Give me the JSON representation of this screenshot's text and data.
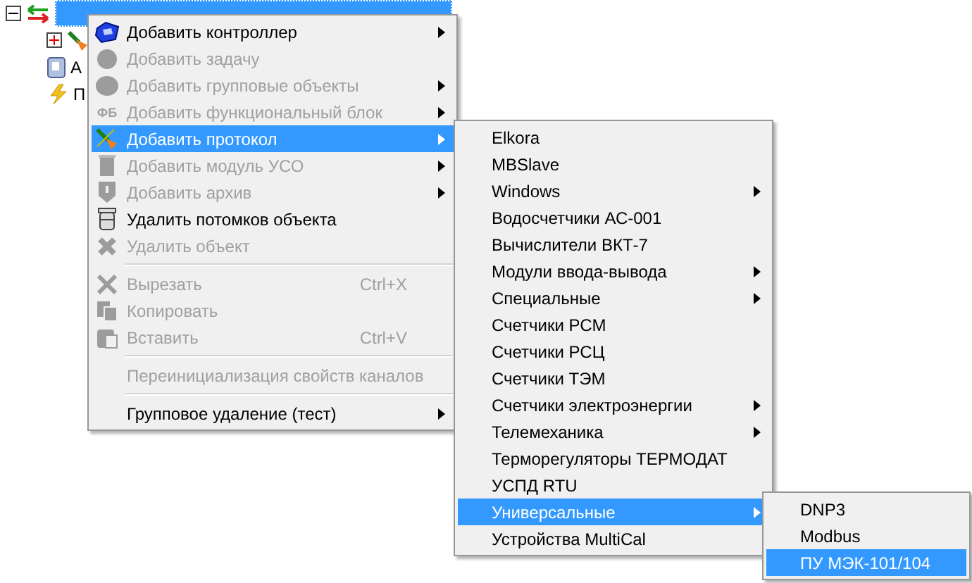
{
  "tree": {
    "items": [
      {
        "expanded": true,
        "selected": true,
        "children": [
          {
            "expanded": false
          },
          {
            "label": "А"
          },
          {
            "label": "П"
          }
        ]
      }
    ]
  },
  "menu": {
    "items": [
      {
        "kind": "item",
        "label": "Добавить контроллер",
        "disabled": false,
        "submenu": true,
        "selected": false
      },
      {
        "kind": "item",
        "label": "Добавить задачу",
        "disabled": true,
        "submenu": false,
        "selected": false
      },
      {
        "kind": "item",
        "label": "Добавить групповые объекты",
        "disabled": true,
        "submenu": true,
        "selected": false
      },
      {
        "kind": "item",
        "label": "Добавить функциональный блок",
        "disabled": true,
        "submenu": true,
        "selected": false,
        "icon_text": "ФБ"
      },
      {
        "kind": "item",
        "label": "Добавить протокол",
        "disabled": false,
        "submenu": true,
        "selected": true
      },
      {
        "kind": "item",
        "label": "Добавить модуль УСО",
        "disabled": true,
        "submenu": true,
        "selected": false
      },
      {
        "kind": "item",
        "label": "Добавить архив",
        "disabled": true,
        "submenu": true,
        "selected": false
      },
      {
        "kind": "item",
        "label": "Удалить потомков объекта",
        "disabled": false,
        "submenu": false,
        "selected": false
      },
      {
        "kind": "item",
        "label": "Удалить объект",
        "disabled": true,
        "submenu": false,
        "selected": false
      },
      {
        "kind": "separator"
      },
      {
        "kind": "item",
        "label": "Вырезать",
        "shortcut": "Ctrl+X",
        "disabled": true,
        "submenu": false,
        "selected": false
      },
      {
        "kind": "item",
        "label": "Копировать",
        "disabled": true,
        "submenu": false,
        "selected": false
      },
      {
        "kind": "item",
        "label": "Вставить",
        "shortcut": "Ctrl+V",
        "disabled": true,
        "submenu": false,
        "selected": false
      },
      {
        "kind": "separator"
      },
      {
        "kind": "item",
        "label": "Переинициализация свойств каналов",
        "disabled": true,
        "submenu": false,
        "selected": false
      },
      {
        "kind": "separator"
      },
      {
        "kind": "item",
        "label": "Групповое удаление (тест)",
        "disabled": false,
        "submenu": true,
        "selected": false
      }
    ]
  },
  "submenu": {
    "items": [
      {
        "label": "Elkora",
        "submenu": false,
        "selected": false
      },
      {
        "label": "MBSlave",
        "submenu": false,
        "selected": false
      },
      {
        "label": "Windows",
        "submenu": true,
        "selected": false
      },
      {
        "label": "Водосчетчики АС-001",
        "submenu": false,
        "selected": false
      },
      {
        "label": "Вычислители ВКТ-7",
        "submenu": false,
        "selected": false
      },
      {
        "label": "Модули ввода-вывода",
        "submenu": true,
        "selected": false
      },
      {
        "label": "Специальные",
        "submenu": true,
        "selected": false
      },
      {
        "label": "Счетчики РСМ",
        "submenu": false,
        "selected": false
      },
      {
        "label": "Счетчики РСЦ",
        "submenu": false,
        "selected": false
      },
      {
        "label": "Счетчики ТЭМ",
        "submenu": false,
        "selected": false
      },
      {
        "label": "Счетчики электроэнергии",
        "submenu": true,
        "selected": false
      },
      {
        "label": "Телемеханика",
        "submenu": true,
        "selected": false
      },
      {
        "label": "Терморегуляторы ТЕРМОДАТ",
        "submenu": false,
        "selected": false
      },
      {
        "label": "УСПД RTU",
        "submenu": false,
        "selected": false
      },
      {
        "label": "Универсальные",
        "submenu": true,
        "selected": true
      },
      {
        "label": "Устройства MultiCal",
        "submenu": false,
        "selected": false
      }
    ]
  },
  "submenu_2": {
    "items": [
      {
        "label": "DNP3",
        "selected": false
      },
      {
        "label": "Modbus",
        "selected": false
      },
      {
        "label": "ПУ МЭК-101/104",
        "selected": true
      }
    ]
  }
}
